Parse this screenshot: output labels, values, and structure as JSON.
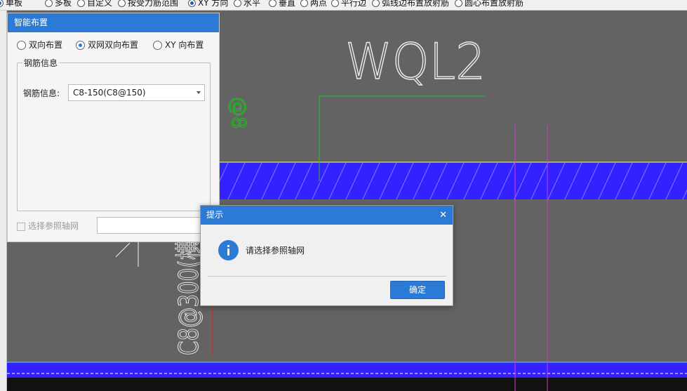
{
  "toolbar": {
    "options": [
      {
        "label": "单板",
        "checked": true
      },
      {
        "label": "多板",
        "checked": false
      },
      {
        "label": "自定义",
        "checked": false
      },
      {
        "label": "按受力筋范围",
        "checked": false
      },
      {
        "label": "XY 方向",
        "checked": true
      },
      {
        "label": "水平",
        "checked": false
      },
      {
        "label": "垂直",
        "checked": false
      },
      {
        "label": "两点",
        "checked": false
      },
      {
        "label": "平行边",
        "checked": false
      },
      {
        "label": "弧线边布置放射筋",
        "checked": false
      },
      {
        "label": "圆心布置放射筋",
        "checked": false
      }
    ]
  },
  "panel": {
    "title": "智能布置",
    "modes": [
      {
        "label": "双向布置",
        "checked": false
      },
      {
        "label": "双网双向布置",
        "checked": true
      },
      {
        "label": "XY 向布置",
        "checked": false
      }
    ],
    "group_title": "钢筋信息",
    "rebar_label": "钢筋信息:",
    "rebar_value": "C8-150(C8@150)",
    "axis_checkbox_label": "选择参照轴网",
    "axis_checkbox_checked": false,
    "axis_input_value": ""
  },
  "dialog": {
    "title": "提示",
    "close_glyph": "✕",
    "message": "请选择参照轴网",
    "ok_label": "确定"
  },
  "canvas": {
    "wall_label": "WQL2",
    "rebar_annotation": "C8@300(横",
    "rebar_small_label": "@8",
    "colors": {
      "background": "#636363",
      "slab_fill": "#3322ff",
      "hatch": "#7d7aff",
      "green_line": "#1fc41f",
      "magenta_line": "#d23ad2",
      "red_line": "#e02020",
      "edge_yellow": "#ffff66",
      "edge_cyan": "#66ccff"
    }
  }
}
